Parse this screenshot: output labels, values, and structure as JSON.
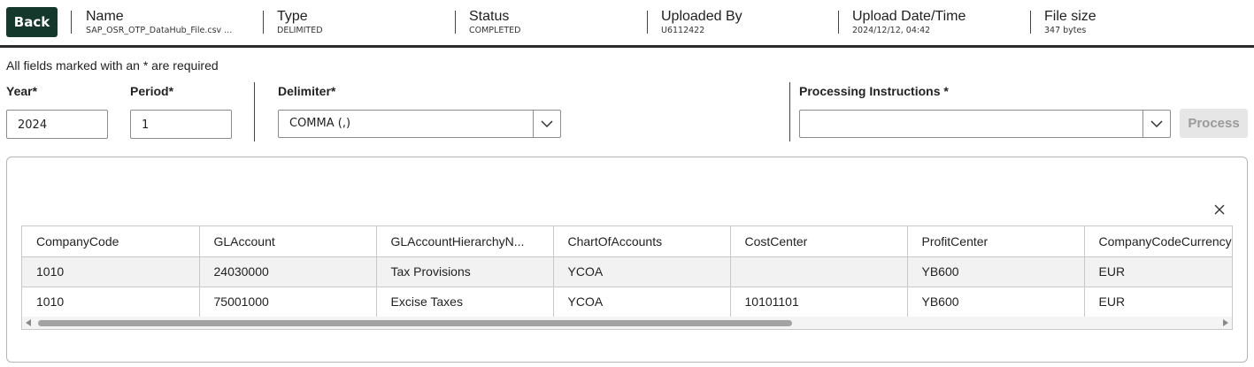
{
  "header": {
    "back_label": "Back",
    "fields": [
      {
        "label": "Name",
        "value": "SAP_OSR_OTP_DataHub_File.csv ..."
      },
      {
        "label": "Type",
        "value": "DELIMITED"
      },
      {
        "label": "Status",
        "value": "COMPLETED"
      },
      {
        "label": "Uploaded By",
        "value": "U6112422"
      },
      {
        "label": "Upload Date/Time",
        "value": "2024/12/12, 04:42"
      },
      {
        "label": "File size",
        "value": "347 bytes"
      }
    ]
  },
  "form": {
    "required_note": "All fields marked with an * are required",
    "year_label": "Year*",
    "year_value": "2024",
    "period_label": "Period*",
    "period_value": "1",
    "delimiter_label": "Delimiter*",
    "delimiter_value": "COMMA (,)",
    "instructions_label": "Processing Instructions *",
    "instructions_value": "",
    "process_label": "Process"
  },
  "preview": {
    "columns": [
      "CompanyCode",
      "GLAccount",
      "GLAccountHierarchyN...",
      "ChartOfAccounts",
      "CostCenter",
      "ProfitCenter",
      "CompanyCodeCurrency"
    ],
    "rows": [
      [
        "1010",
        "24030000",
        "Tax Provisions",
        "YCOA",
        "",
        "YB600",
        "EUR"
      ],
      [
        "1010",
        "75001000",
        "Excise Taxes",
        "YCOA",
        "10101101",
        "YB600",
        "EUR"
      ]
    ],
    "close_icon": "close-icon"
  },
  "colors": {
    "back_button": "#14382c",
    "process_disabled_bg": "#e6e6e6",
    "process_disabled_text": "#9a9a9a",
    "row_stripe": "#f2f2f2"
  }
}
